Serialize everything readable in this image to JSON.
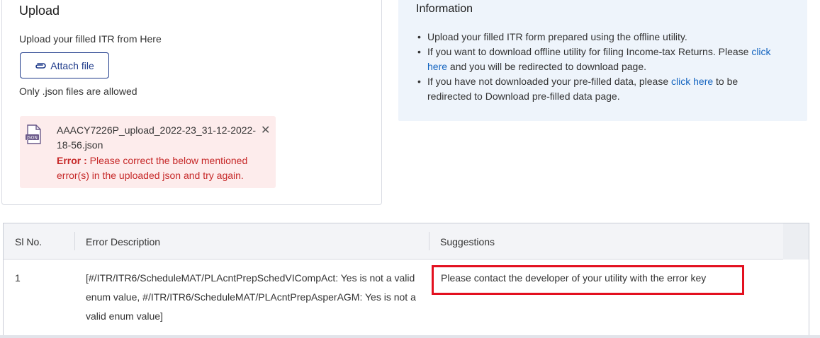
{
  "upload": {
    "title": "Upload",
    "subtitle": "Upload your filled ITR from Here",
    "attach_label": "Attach file",
    "allowed_note": "Only .json files are allowed",
    "file": {
      "icon": "json-file-icon",
      "name": "AAACY7226P_upload_2022-23_31-12-2022-18-56.json",
      "error_label": "Error :",
      "error_message": " Please correct the below mentioned error(s) in the uploaded json and try again."
    }
  },
  "information": {
    "title": "Information",
    "items": [
      {
        "text": "Upload your filled ITR form prepared using the offline utility."
      },
      {
        "pre": "If you want to download offline utility for filing Income-tax Returns. Please ",
        "link": "click here",
        "post": " and you will be redirected to download page."
      },
      {
        "pre": "If you have not downloaded your pre-filled data, please ",
        "link": "click here",
        "post": " to be redirected to Download pre-filled data page."
      }
    ]
  },
  "errors_table": {
    "headers": [
      "Sl No.",
      "Error Description",
      "Suggestions"
    ],
    "rows": [
      {
        "sl": "1",
        "description": "[#/ITR/ITR6/ScheduleMAT/PLAcntPrepSchedVICompAct: Yes is not a valid enum value, #/ITR/ITR6/ScheduleMAT/PLAcntPrepAsperAGM: Yes is not a valid enum value]",
        "suggestion": "Please contact the developer of your utility with the error key"
      }
    ]
  },
  "colors": {
    "accent": "#1e3a8a",
    "error": "#c62828",
    "link": "#1565c0",
    "highlight": "#e3101f"
  }
}
